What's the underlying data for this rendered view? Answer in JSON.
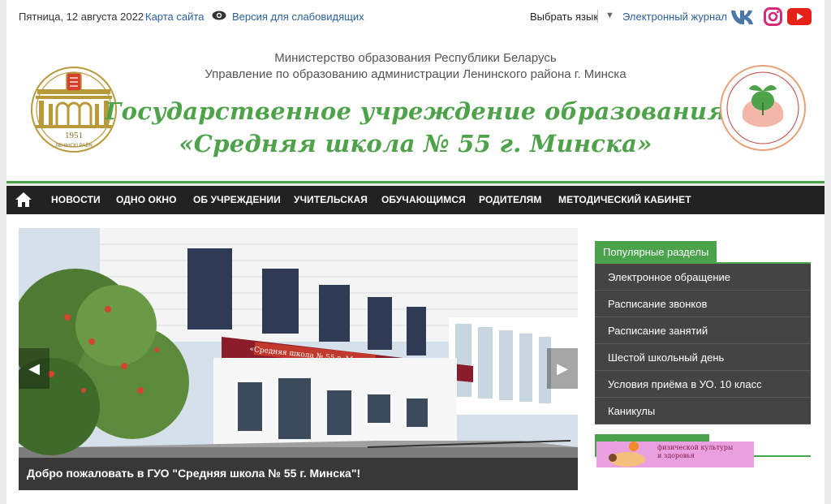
{
  "topbar": {
    "date": "Пятница, 12 августа 2022",
    "sitemap": "Карта сайта",
    "vision": "Версия для слабовидящих",
    "language": "Выбрать язык",
    "journal": "Электронный журнал"
  },
  "header": {
    "ministry": "Министерство образования Республики Беларусь",
    "department": "Управление по образованию администрации Ленинского района г. Минска",
    "title_line1": "Государственное учреждение образования",
    "title_line2": "«Средняя школа № 55 г. Минска»",
    "logo_left_year": "1951",
    "logo_left_caption": "ЛЕНІНСКІ РАЁН"
  },
  "nav": {
    "items": [
      "НОВОСТИ",
      "ОДНО ОКНО",
      "ОБ УЧРЕЖДЕНИИ",
      "УЧИТЕЛЬСКАЯ",
      "ОБУЧАЮЩИМСЯ",
      "РОДИТЕЛЯМ",
      "МЕТОДИЧЕСКИЙ КАБИНЕТ"
    ]
  },
  "slider": {
    "caption": "Добро пожаловать в ГУО \"Средняя школа № 55 г. Минска\"!",
    "sign_text": "«Средняя школа № 55 г. Минска»"
  },
  "sidebar": {
    "popular_title": "Популярные разделы",
    "items": [
      "Электронное обращение",
      "Расписание звонков",
      "Расписание занятий",
      "Шестой школьный день",
      "Условия приёма в УО. 10 класс",
      "Каникулы"
    ],
    "attention_title": "Обратите внимание",
    "banner_text1": "физической культуры",
    "banner_text2": "и здоровья"
  },
  "colors": {
    "accent_green": "#4aa34a",
    "nav_dark": "#222222",
    "link_blue": "#2a5f9e"
  }
}
